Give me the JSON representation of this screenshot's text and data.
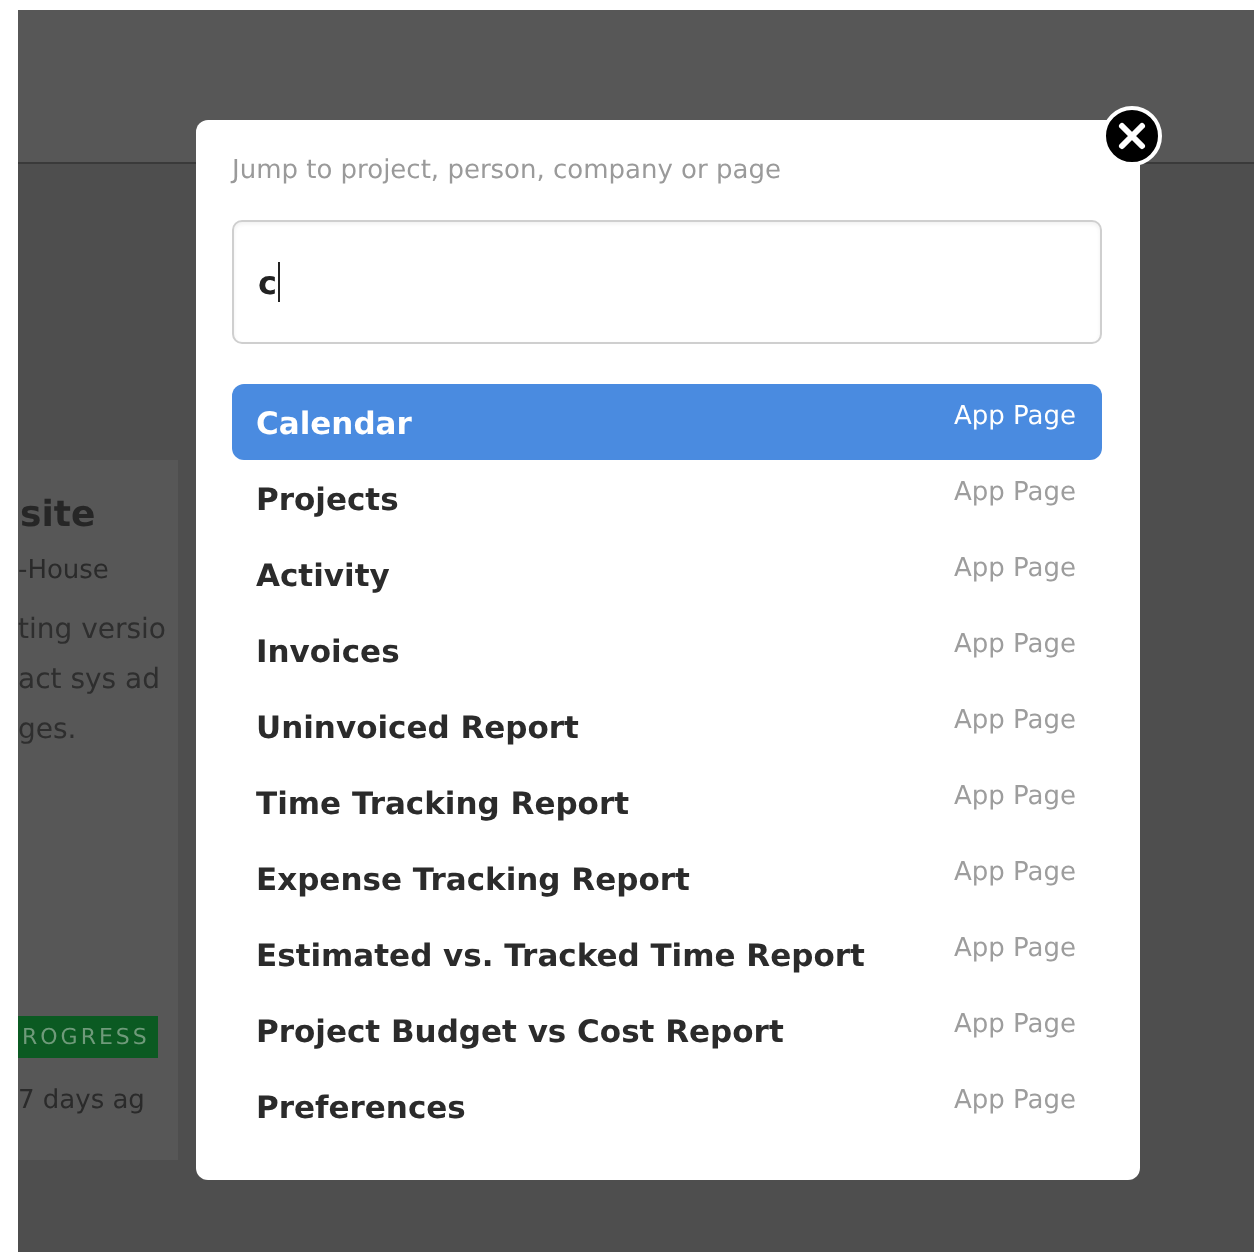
{
  "background_card": {
    "title": "site",
    "subtitle": "-House",
    "description_lines": [
      "ting versio",
      "act sys ad",
      "ges."
    ],
    "status_badge": "ROGRESS",
    "updated": "7 days ag"
  },
  "jump_dialog": {
    "hint": "Jump to project, person, company or page",
    "search": {
      "value": "c"
    },
    "results": [
      {
        "label": "Calendar",
        "type": "App Page",
        "selected": true
      },
      {
        "label": "Projects",
        "type": "App Page",
        "selected": false
      },
      {
        "label": "Activity",
        "type": "App Page",
        "selected": false
      },
      {
        "label": "Invoices",
        "type": "App Page",
        "selected": false
      },
      {
        "label": "Uninvoiced Report",
        "type": "App Page",
        "selected": false
      },
      {
        "label": "Time Tracking Report",
        "type": "App Page",
        "selected": false
      },
      {
        "label": "Expense Tracking Report",
        "type": "App Page",
        "selected": false
      },
      {
        "label": "Estimated vs. Tracked Time Report",
        "type": "App Page",
        "selected": false
      },
      {
        "label": "Project Budget vs Cost Report",
        "type": "App Page",
        "selected": false
      },
      {
        "label": "Preferences",
        "type": "App Page",
        "selected": false
      }
    ]
  }
}
